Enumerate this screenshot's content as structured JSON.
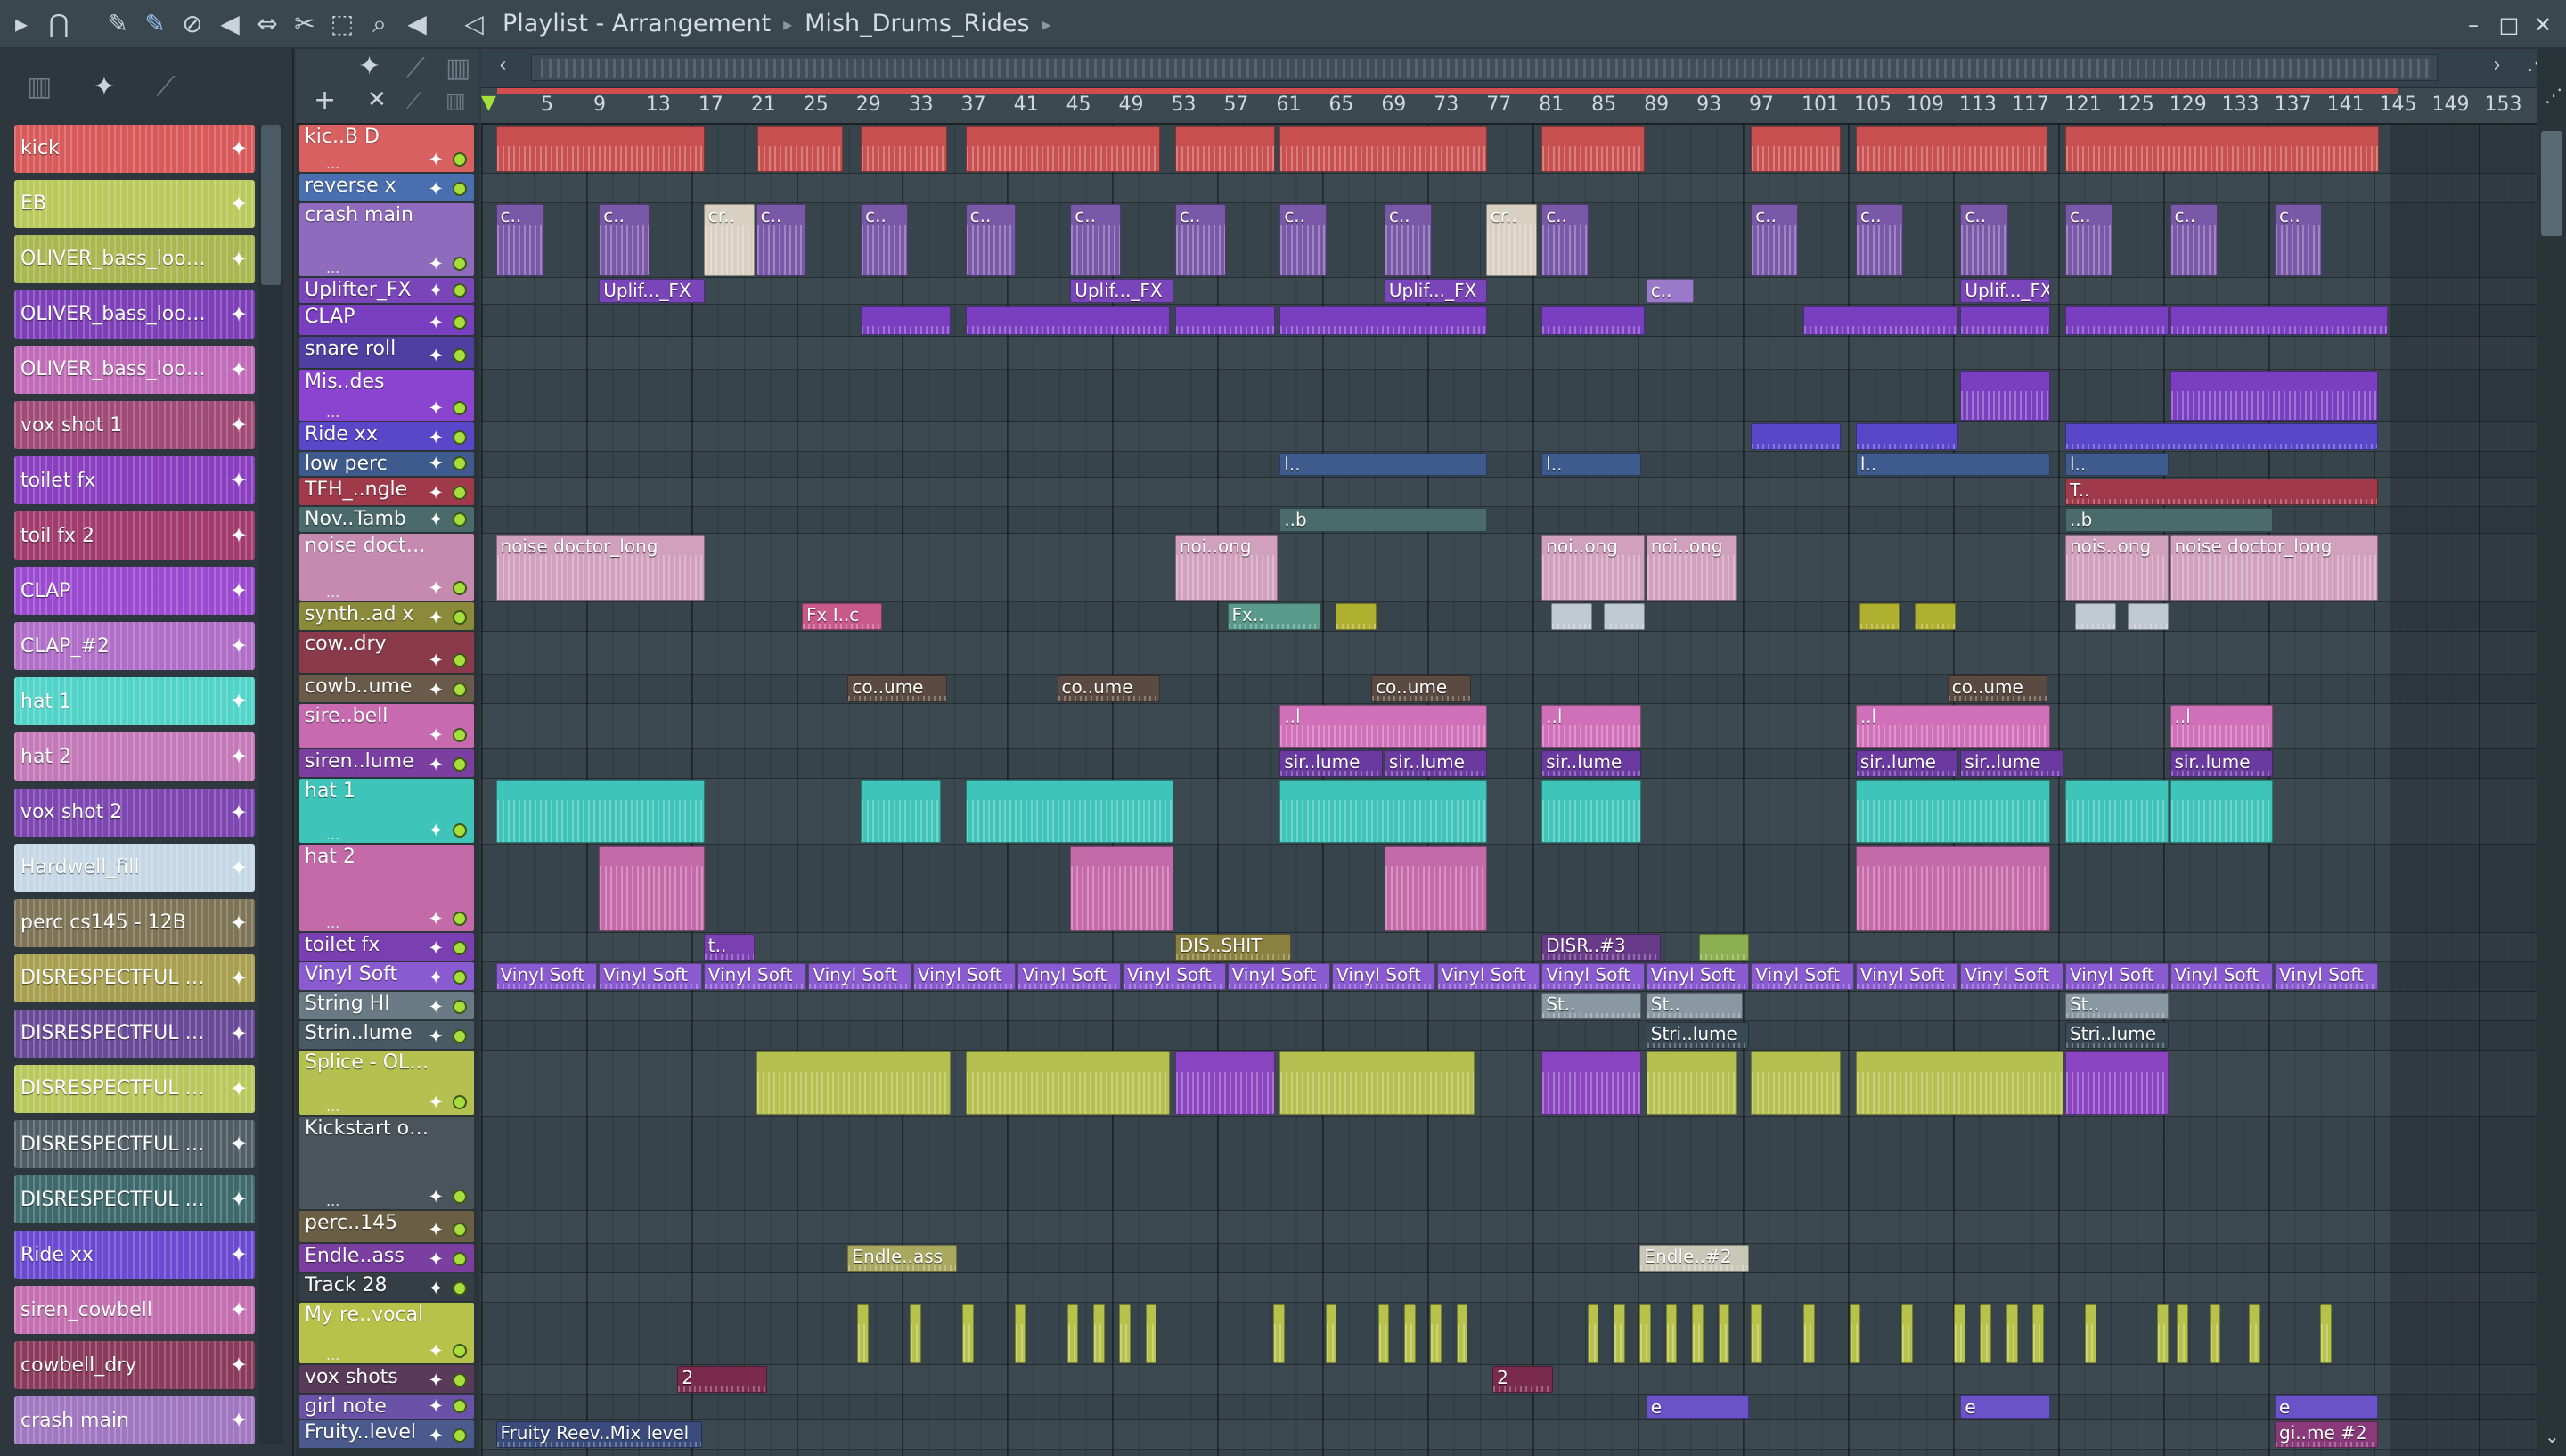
{
  "window": {
    "title_parts": [
      "Playlist - Arrangement",
      "Mish_Drums_Rides"
    ]
  },
  "toolbar": {
    "icons": [
      "play-icon",
      "magnet-icon",
      "pencil-icon",
      "paint-icon",
      "delete-icon",
      "mute-icon",
      "slip-icon",
      "slice-icon",
      "select-icon",
      "zoom-icon",
      "playback-icon",
      "speaker-icon"
    ]
  },
  "ruler": {
    "bars": [
      "5",
      "9",
      "13",
      "17",
      "21",
      "25",
      "29",
      "33",
      "37",
      "41",
      "45",
      "49",
      "53",
      "57",
      "61",
      "65",
      "69",
      "73",
      "77",
      "81",
      "85",
      "89",
      "93",
      "97",
      "101",
      "105",
      "109",
      "113",
      "117",
      "121",
      "125",
      "129",
      "133",
      "137",
      "141",
      "145",
      "149",
      "153"
    ]
  },
  "browser": {
    "clips": [
      {
        "label": "kick",
        "color": "#d85a5a"
      },
      {
        "label": "EB",
        "color": "#b9c95c"
      },
      {
        "label": "OLIVER_bass_loop_...",
        "color": "#a8b750"
      },
      {
        "label": "OLIVER_bass_loop_...",
        "color": "#7c3fb8"
      },
      {
        "label": "OLIVER_bass_loop_...",
        "color": "#c06ab8"
      },
      {
        "label": "vox shot 1",
        "color": "#a04a76"
      },
      {
        "label": "toilet fx",
        "color": "#8a3fc0"
      },
      {
        "label": "toil fx 2",
        "color": "#a23c6e"
      },
      {
        "label": "CLAP",
        "color": "#9b4ad0"
      },
      {
        "label": "CLAP_#2",
        "color": "#b06ec8"
      },
      {
        "label": "hat 1",
        "color": "#53d4c8"
      },
      {
        "label": "hat 2",
        "color": "#c47ab8"
      },
      {
        "label": "vox shot 2",
        "color": "#7d46b0"
      },
      {
        "label": "Hardwell_fill",
        "color": "#c6d8e6"
      },
      {
        "label": "perc cs145 - 12B",
        "color": "#7e7456"
      },
      {
        "label": "DISRESPECTFUL SHIT",
        "color": "#a8a050"
      },
      {
        "label": "DISRESPECTFUL SHIT...",
        "color": "#6a4a98"
      },
      {
        "label": "DISRESPECTFUL SHIT...",
        "color": "#b9c85c"
      },
      {
        "label": "DISRESPECTFUL SHIT...",
        "color": "#515e66"
      },
      {
        "label": "DISRESPECTFUL SHIT...",
        "color": "#3f6a6c"
      },
      {
        "label": "Ride xx",
        "color": "#6a4ad0"
      },
      {
        "label": "siren_cowbell",
        "color": "#c470b0"
      },
      {
        "label": "cowbell_dry",
        "color": "#8a3a5a"
      },
      {
        "label": "crash main",
        "color": "#a077c0"
      }
    ]
  },
  "tracks": [
    {
      "name": "kic..B D",
      "color": "#d86060"
    },
    {
      "name": "reverse x",
      "color": "#4a6fb0"
    },
    {
      "name": "crash main",
      "color": "#8e6bbd"
    },
    {
      "name": "Uplifter_FX",
      "color": "#7a45b8"
    },
    {
      "name": "CLAP",
      "color": "#7a3fc0"
    },
    {
      "name": "snare roll",
      "color": "#4e3fa0"
    },
    {
      "name": "Mis..des",
      "color": "#8a44d0"
    },
    {
      "name": "Ride xx",
      "color": "#5a46c8"
    },
    {
      "name": "low perc",
      "color": "#3f5a8c"
    },
    {
      "name": "TFH_..ngle",
      "color": "#a03a4a"
    },
    {
      "name": "Nov..Tamb",
      "color": "#4a6a6c"
    },
    {
      "name": "noise doctor_lo...",
      "color": "#c68ab0"
    },
    {
      "name": "synth..ad x",
      "color": "#8a8a3a"
    },
    {
      "name": "cow..dry",
      "color": "#8a3a4a"
    },
    {
      "name": "cowb..ume",
      "color": "#6a5a4a"
    },
    {
      "name": "sire..bell",
      "color": "#c86ab0"
    },
    {
      "name": "siren..lume",
      "color": "#7a3fa0"
    },
    {
      "name": "hat 1",
      "color": "#3ec4b8"
    },
    {
      "name": "hat 2",
      "color": "#c46aa8"
    },
    {
      "name": "toilet fx",
      "color": "#7a3fb0"
    },
    {
      "name": "Vinyl Soft",
      "color": "#8a5ad0"
    },
    {
      "name": "String HI",
      "color": "#6a7a84"
    },
    {
      "name": "Strin..lume",
      "color": "#4a5a64"
    },
    {
      "name": "Splice - OLIVER",
      "color": "#b4c050"
    },
    {
      "name": "Kickstart off bass",
      "color": "#4a545a"
    },
    {
      "name": "perc..145",
      "color": "#6a5e44"
    },
    {
      "name": "Endle..ass",
      "color": "#7a3fa0"
    },
    {
      "name": "Track 28",
      "color": "#343e44"
    },
    {
      "name": "My re..vocal",
      "color": "#b6c24a"
    },
    {
      "name": "vox shots",
      "color": "#5a3a5a"
    },
    {
      "name": "girl note",
      "color": "#6a52a8"
    },
    {
      "name": "Fruity..level",
      "color": "#4a5a8c"
    }
  ],
  "clips": [
    {
      "lane": 0,
      "label": "",
      "color": "#c85050",
      "segments": [
        [
          303,
          432
        ],
        [
          463,
          516
        ],
        [
          526,
          580
        ],
        [
          590,
          710
        ],
        [
          718,
          780
        ],
        [
          782,
          910
        ],
        [
          942,
          1006
        ],
        [
          1070,
          1126
        ],
        [
          1134,
          1252
        ],
        [
          1262,
          1455
        ]
      ]
    },
    {
      "lane": 2,
      "label": "c..",
      "color": "#7a58a8",
      "segments": [
        [
          303,
          334
        ],
        [
          366,
          398
        ],
        [
          462,
          494
        ],
        [
          526,
          556
        ],
        [
          590,
          622
        ],
        [
          654,
          686
        ],
        [
          718,
          750
        ],
        [
          782,
          812
        ],
        [
          846,
          876
        ],
        [
          942,
          972
        ],
        [
          1070,
          1100
        ],
        [
          1134,
          1164
        ],
        [
          1198,
          1228
        ],
        [
          1262,
          1292
        ],
        [
          1326,
          1356
        ],
        [
          1390,
          1420
        ]
      ]
    },
    {
      "lane": 2,
      "label": "cr..",
      "color": "#d8d0c0",
      "segments": [
        [
          430,
          462
        ],
        [
          908,
          940
        ]
      ]
    },
    {
      "lane": 3,
      "label": "Uplif..._FX",
      "color": "#7a45b8",
      "segments": [
        [
          366,
          432
        ],
        [
          654,
          718
        ],
        [
          846,
          910
        ],
        [
          1198,
          1254
        ]
      ]
    },
    {
      "lane": 3,
      "label": "c..",
      "color": "#9a7ac8",
      "segments": [
        [
          1006,
          1036
        ]
      ]
    },
    {
      "lane": 4,
      "label": "",
      "color": "#7a3fc0",
      "segments": [
        [
          526,
          582
        ],
        [
          590,
          716
        ],
        [
          718,
          780
        ],
        [
          782,
          910
        ],
        [
          942,
          1006
        ],
        [
          1102,
          1198
        ],
        [
          1198,
          1254
        ],
        [
          1262,
          1326
        ],
        [
          1326,
          1460
        ]
      ]
    },
    {
      "lane": 6,
      "label": "",
      "color": "#7a3fc0",
      "segments": [
        [
          1198,
          1254
        ],
        [
          1326,
          1454
        ]
      ]
    },
    {
      "lane": 7,
      "label": "",
      "color": "#5a46c8",
      "segments": [
        [
          1070,
          1126
        ],
        [
          1134,
          1198
        ],
        [
          1262,
          1454
        ]
      ]
    },
    {
      "lane": 8,
      "label": "l..",
      "color": "#3f5a8c",
      "segments": [
        [
          782,
          910
        ],
        [
          942,
          1004
        ],
        [
          1134,
          1254
        ],
        [
          1262,
          1326
        ]
      ]
    },
    {
      "lane": 9,
      "label": "T..",
      "color": "#a03a4a",
      "segments": [
        [
          1262,
          1454
        ]
      ]
    },
    {
      "lane": 10,
      "label": "..b",
      "color": "#4a6a6c",
      "segments": [
        [
          782,
          910
        ],
        [
          1262,
          1390
        ]
      ]
    },
    {
      "lane": 11,
      "label": "noise doctor_long",
      "color": "#d0a0bc",
      "segments": [
        [
          303,
          432
        ]
      ]
    },
    {
      "lane": 11,
      "label": "noi..ong",
      "color": "#d0a0bc",
      "segments": [
        [
          718,
          782
        ],
        [
          942,
          1006
        ],
        [
          1006,
          1062
        ]
      ]
    },
    {
      "lane": 11,
      "label": "nois..ong",
      "color": "#d0a0bc",
      "segments": [
        [
          1262,
          1326
        ]
      ]
    },
    {
      "lane": 11,
      "label": "noise doctor_long",
      "color": "#d0a0bc",
      "segments": [
        [
          1326,
          1454
        ]
      ]
    },
    {
      "lane": 12,
      "label": "Fx I..c",
      "color": "#c85a8a",
      "segments": [
        [
          490,
          540
        ]
      ]
    },
    {
      "lane": 12,
      "label": "Fx..",
      "color": "#5a9a8a",
      "segments": [
        [
          750,
          808
        ]
      ]
    },
    {
      "lane": 12,
      "label": "",
      "color": "#b0b030",
      "segments": [
        [
          816,
          842
        ],
        [
          1136,
          1162
        ],
        [
          1170,
          1196
        ]
      ]
    },
    {
      "lane": 12,
      "label": "",
      "color": "#c0c8d0",
      "segments": [
        [
          948,
          974
        ],
        [
          980,
          1006
        ],
        [
          1268,
          1294
        ],
        [
          1300,
          1326
        ]
      ]
    },
    {
      "lane": 14,
      "label": "co..ume",
      "color": "#5a4a42",
      "segments": [
        [
          518,
          580
        ],
        [
          646,
          710
        ],
        [
          838,
          900
        ],
        [
          1190,
          1252
        ]
      ]
    },
    {
      "lane": 15,
      "label": "..l",
      "color": "#d070b8",
      "segments": [
        [
          782,
          910
        ],
        [
          942,
          1004
        ],
        [
          1134,
          1254
        ],
        [
          1326,
          1390
        ]
      ]
    },
    {
      "lane": 16,
      "label": "sir..lume",
      "color": "#6a3aa0",
      "segments": [
        [
          782,
          846
        ],
        [
          846,
          910
        ],
        [
          942,
          1004
        ],
        [
          1134,
          1198
        ],
        [
          1198,
          1262
        ],
        [
          1326,
          1390
        ]
      ]
    },
    {
      "lane": 17,
      "label": "",
      "color": "#3ec4b8",
      "segments": [
        [
          303,
          432
        ],
        [
          526,
          576
        ],
        [
          590,
          718
        ],
        [
          782,
          910
        ],
        [
          942,
          1004
        ],
        [
          1134,
          1254
        ],
        [
          1262,
          1326
        ],
        [
          1326,
          1390
        ]
      ]
    },
    {
      "lane": 18,
      "label": "",
      "color": "#c46aa8",
      "segments": [
        [
          366,
          432
        ],
        [
          654,
          718
        ],
        [
          846,
          910
        ],
        [
          1134,
          1254
        ]
      ]
    },
    {
      "lane": 19,
      "label": "t..",
      "color": "#7a3fb0",
      "segments": [
        [
          430,
          462
        ]
      ]
    },
    {
      "lane": 19,
      "label": "DIS..SHIT",
      "color": "#8a8040",
      "segments": [
        [
          718,
          790
        ]
      ]
    },
    {
      "lane": 19,
      "label": "DISR..#3",
      "color": "#6a3a8a",
      "segments": [
        [
          942,
          1016
        ]
      ]
    },
    {
      "lane": 19,
      "label": "",
      "color": "#8ab050",
      "segments": [
        [
          1038,
          1070
        ]
      ]
    },
    {
      "lane": 20,
      "label": "Vinyl Soft",
      "color": "#8a5ad0",
      "segments": [
        [
          303,
          366
        ],
        [
          366,
          430
        ],
        [
          430,
          494
        ],
        [
          494,
          558
        ],
        [
          558,
          622
        ],
        [
          622,
          686
        ],
        [
          686,
          750
        ],
        [
          750,
          814
        ],
        [
          814,
          878
        ],
        [
          878,
          942
        ],
        [
          942,
          1006
        ],
        [
          1006,
          1070
        ],
        [
          1070,
          1134
        ],
        [
          1134,
          1198
        ],
        [
          1198,
          1262
        ],
        [
          1262,
          1326
        ],
        [
          1326,
          1390
        ],
        [
          1390,
          1454
        ]
      ]
    },
    {
      "lane": 21,
      "label": "St..",
      "color": "#8a98a2",
      "segments": [
        [
          942,
          1004
        ],
        [
          1006,
          1066
        ],
        [
          1262,
          1326
        ]
      ]
    },
    {
      "lane": 22,
      "label": "Stri..lume",
      "color": "#3a4a54",
      "segments": [
        [
          1006,
          1070
        ],
        [
          1262,
          1326
        ]
      ]
    },
    {
      "lane": 23,
      "label": "",
      "color": "#b4c050",
      "segments": [
        [
          462,
          582
        ],
        [
          590,
          716
        ],
        [
          782,
          902
        ],
        [
          1006,
          1062
        ],
        [
          1070,
          1126
        ],
        [
          1134,
          1262
        ]
      ]
    },
    {
      "lane": 23,
      "label": "",
      "color": "#8a44c0",
      "segments": [
        [
          718,
          780
        ],
        [
          942,
          1004
        ],
        [
          1262,
          1326
        ]
      ]
    },
    {
      "lane": 26,
      "label": "Endle..ass",
      "color": "#a8a860",
      "segments": [
        [
          518,
          586
        ]
      ]
    },
    {
      "lane": 26,
      "label": "Endle..#2",
      "color": "#c8c8b8",
      "segments": [
        [
          1002,
          1070
        ]
      ]
    },
    {
      "lane": 28,
      "label": "",
      "color": "#b6c24a",
      "segments": [
        [
          524,
          532
        ],
        [
          556,
          564
        ],
        [
          588,
          596
        ],
        [
          620,
          628
        ],
        [
          652,
          660
        ],
        [
          668,
          676
        ],
        [
          684,
          692
        ],
        [
          700,
          708
        ],
        [
          778,
          786
        ],
        [
          810,
          818
        ],
        [
          842,
          850
        ],
        [
          858,
          866
        ],
        [
          874,
          882
        ],
        [
          890,
          898
        ],
        [
          970,
          978
        ],
        [
          986,
          994
        ],
        [
          1002,
          1010
        ],
        [
          1018,
          1026
        ],
        [
          1034,
          1042
        ],
        [
          1050,
          1058
        ],
        [
          1070,
          1078
        ],
        [
          1102,
          1110
        ],
        [
          1130,
          1138
        ],
        [
          1162,
          1170
        ],
        [
          1194,
          1202
        ],
        [
          1210,
          1218
        ],
        [
          1226,
          1234
        ],
        [
          1242,
          1250
        ],
        [
          1274,
          1282
        ],
        [
          1318,
          1326
        ],
        [
          1330,
          1338
        ],
        [
          1350,
          1358
        ],
        [
          1374,
          1382
        ],
        [
          1418,
          1426
        ]
      ]
    },
    {
      "lane": 29,
      "label": "2",
      "color": "#7a2a4a",
      "segments": [
        [
          414,
          470
        ],
        [
          912,
          950
        ]
      ]
    },
    {
      "lane": 30,
      "label": "e",
      "color": "#6a52c8",
      "segments": [
        [
          1006,
          1070
        ],
        [
          1198,
          1254
        ],
        [
          1390,
          1454
        ]
      ]
    },
    {
      "lane": 31,
      "label": "Fruity Reev..Mix level",
      "color": "#3a4a7a",
      "segments": [
        [
          303,
          430
        ]
      ]
    },
    {
      "lane": 31,
      "label": "gi..me #2",
      "color": "#8a3a7a",
      "segments": [
        [
          1390,
          1454
        ]
      ]
    }
  ],
  "vscroll": {}
}
